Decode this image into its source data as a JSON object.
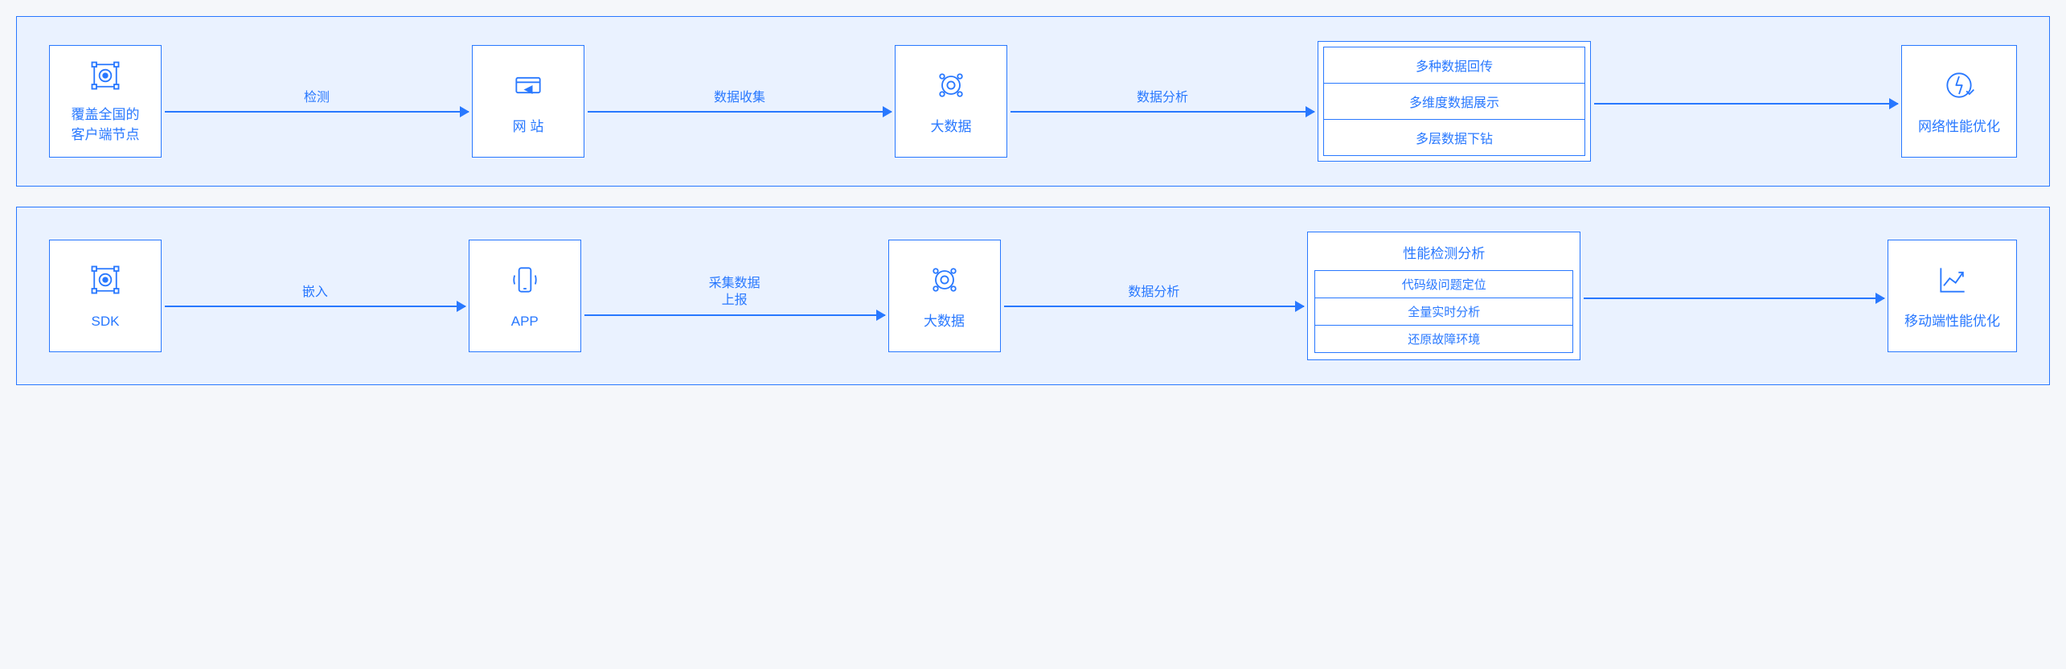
{
  "flows": [
    {
      "id": "web",
      "nodes": [
        {
          "type": "icon",
          "icon": "nodes",
          "label": "覆盖全国的\n客户端节点"
        },
        {
          "type": "arrow",
          "label": "检测"
        },
        {
          "type": "icon",
          "icon": "website",
          "label": "网  站"
        },
        {
          "type": "arrow",
          "label": "数据收集"
        },
        {
          "type": "icon",
          "icon": "bigdata",
          "label": "大数据"
        },
        {
          "type": "arrow",
          "label": "数据分析"
        },
        {
          "type": "list",
          "items": [
            "多种数据回传",
            "多维度数据展示",
            "多层数据下钻"
          ]
        },
        {
          "type": "arrow",
          "label": ""
        },
        {
          "type": "icon",
          "icon": "optimize",
          "label": "网络性能优化"
        }
      ]
    },
    {
      "id": "mobile",
      "nodes": [
        {
          "type": "icon",
          "icon": "nodes",
          "label": "SDK"
        },
        {
          "type": "arrow",
          "label": "嵌入"
        },
        {
          "type": "icon",
          "icon": "app",
          "label": "APP"
        },
        {
          "type": "arrow",
          "label": "采集数据\n上报"
        },
        {
          "type": "icon",
          "icon": "bigdata",
          "label": "大数据"
        },
        {
          "type": "arrow",
          "label": "数据分析"
        },
        {
          "type": "headerlist",
          "header": "性能检测分析",
          "items": [
            "代码级问题定位",
            "全量实时分析",
            "还原故障环境"
          ]
        },
        {
          "type": "arrow",
          "label": ""
        },
        {
          "type": "icon",
          "icon": "chart",
          "label": "移动端性能优化"
        }
      ]
    }
  ]
}
